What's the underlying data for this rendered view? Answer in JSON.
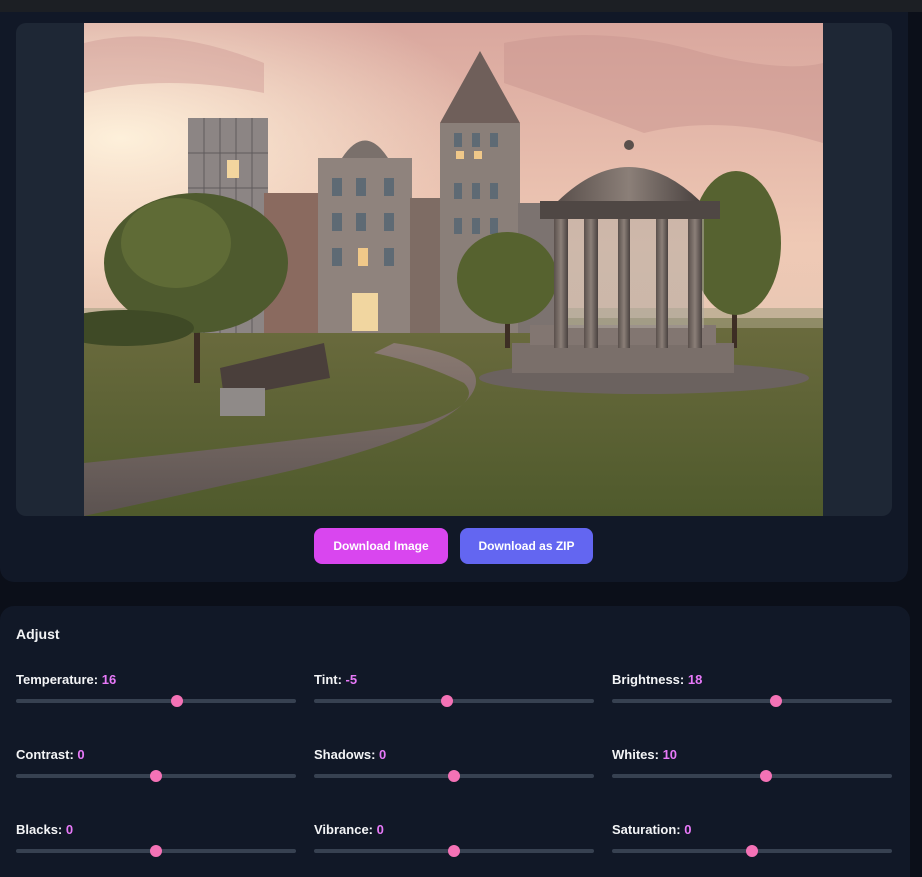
{
  "buttons": {
    "download_image": "Download Image",
    "download_zip": "Download as ZIP"
  },
  "adjust": {
    "title": "Adjust",
    "controls": [
      {
        "label": "Temperature:",
        "value": "16",
        "position": 0.575
      },
      {
        "label": "Tint:",
        "value": "-5",
        "position": 0.475
      },
      {
        "label": "Brightness:",
        "value": "18",
        "position": 0.585
      },
      {
        "label": "Contrast:",
        "value": "0",
        "position": 0.5
      },
      {
        "label": "Shadows:",
        "value": "0",
        "position": 0.5
      },
      {
        "label": "Whites:",
        "value": "10",
        "position": 0.55
      },
      {
        "label": "Blacks:",
        "value": "0",
        "position": 0.5
      },
      {
        "label": "Vibrance:",
        "value": "0",
        "position": 0.5
      },
      {
        "label": "Saturation:",
        "value": "0",
        "position": 0.5
      }
    ]
  },
  "colors": {
    "accent_pink": "#e879f9",
    "download_button": "#d946ef",
    "zip_button": "#6366f1",
    "thumb": "#f472b6"
  }
}
